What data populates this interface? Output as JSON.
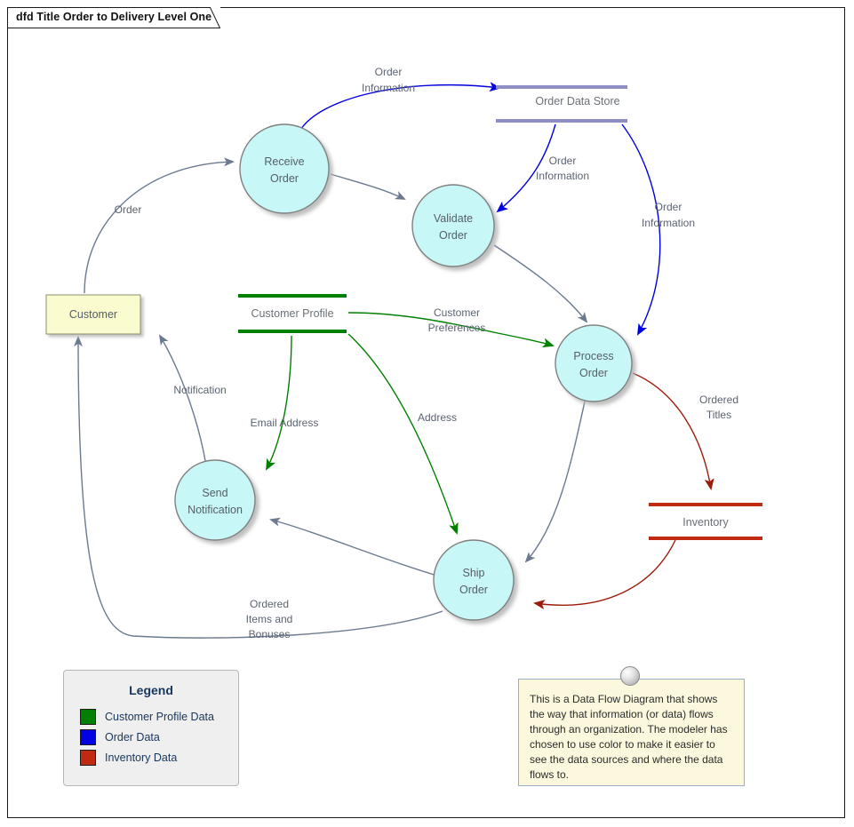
{
  "window": {
    "title_tab": "dfd Title Order to Delivery Level One"
  },
  "colors": {
    "order_data": "#0000e0",
    "customer_profile_data": "#008000",
    "inventory_data": "#c02a12",
    "generic_flow": "#6b7a90",
    "process_fill": "#c8f7f7",
    "process_stroke": "#808080",
    "entity_fill": "#fbfbd0",
    "entity_stroke": "#8d8d6e",
    "store_order": "#8e8ec4",
    "note_fill": "#fbf8dd",
    "legend_fill": "#efefef"
  },
  "processes": [
    {
      "id": "receive-order",
      "label_line1": "Receive",
      "label_line2": "Order"
    },
    {
      "id": "validate-order",
      "label_line1": "Validate",
      "label_line2": "Order"
    },
    {
      "id": "process-order",
      "label_line1": "Process",
      "label_line2": "Order"
    },
    {
      "id": "ship-order",
      "label_line1": "Ship",
      "label_line2": "Order"
    },
    {
      "id": "send-notification",
      "label_line1": "Send",
      "label_line2": "Notification"
    }
  ],
  "data_stores": [
    {
      "id": "order-data-store",
      "label": "Order Data Store",
      "color": "#8e8ec4"
    },
    {
      "id": "customer-profile-store",
      "label": "Customer Profile",
      "color": "#008000"
    },
    {
      "id": "inventory-store",
      "label": "Inventory",
      "color": "#c02a12"
    }
  ],
  "external_entities": [
    {
      "id": "customer-entity",
      "label": "Customer"
    }
  ],
  "flows": [
    {
      "id": "flow-order",
      "label": "Order",
      "lines": [
        "Order"
      ],
      "color": "#6b7a90",
      "from": "customer-entity",
      "to": "receive-order"
    },
    {
      "id": "flow-order-information-store-in",
      "label": "Order Information",
      "lines": [
        "Order",
        "Information"
      ],
      "color": "#0000e0",
      "from": "receive-order",
      "to": "order-data-store"
    },
    {
      "id": "flow-order-information-validate",
      "label": "Order Information",
      "lines": [
        "Order",
        "Information"
      ],
      "color": "#0000e0",
      "from": "order-data-store",
      "to": "validate-order"
    },
    {
      "id": "flow-order-information-process",
      "label": "Order Information",
      "lines": [
        "Order",
        "Information"
      ],
      "color": "#0000e0",
      "from": "order-data-store",
      "to": "process-order"
    },
    {
      "id": "flow-receive-to-validate",
      "label": "",
      "lines": [],
      "color": "#6b7a90",
      "from": "receive-order",
      "to": "validate-order"
    },
    {
      "id": "flow-validate-to-process",
      "label": "",
      "lines": [],
      "color": "#6b7a90",
      "from": "validate-order",
      "to": "process-order"
    },
    {
      "id": "flow-customer-preferences",
      "label": "Customer Preferences",
      "lines": [
        "Customer",
        "Preferences"
      ],
      "color": "#008000",
      "from": "customer-profile-store",
      "to": "process-order"
    },
    {
      "id": "flow-email-address",
      "label": "Email Address",
      "lines": [
        "Email Address"
      ],
      "color": "#008000",
      "from": "customer-profile-store",
      "to": "send-notification"
    },
    {
      "id": "flow-address",
      "label": "Address",
      "lines": [
        "Address"
      ],
      "color": "#008000",
      "from": "customer-profile-store",
      "to": "ship-order"
    },
    {
      "id": "flow-ordered-titles",
      "label": "Ordered Titles",
      "lines": [
        "Ordered",
        "Titles"
      ],
      "color": "#c02a12",
      "from": "process-order",
      "to": "inventory-store"
    },
    {
      "id": "flow-inventory-to-ship",
      "label": "",
      "lines": [],
      "color": "#c02a12",
      "from": "inventory-store",
      "to": "ship-order"
    },
    {
      "id": "flow-process-to-ship",
      "label": "",
      "lines": [],
      "color": "#6b7a90",
      "from": "process-order",
      "to": "ship-order"
    },
    {
      "id": "flow-notification",
      "label": "Notification",
      "lines": [
        "Notification"
      ],
      "color": "#6b7a90",
      "from": "send-notification",
      "to": "customer-entity"
    },
    {
      "id": "flow-ship-to-send-notification",
      "label": "",
      "lines": [],
      "color": "#6b7a90",
      "from": "ship-order",
      "to": "send-notification"
    },
    {
      "id": "flow-ordered-items-and-bonuses",
      "label": "Ordered Items and Bonuses",
      "lines": [
        "Ordered",
        "Items and",
        "Bonuses"
      ],
      "color": "#6b7a90",
      "from": "ship-order",
      "to": "customer-entity"
    }
  ],
  "legend": {
    "title": "Legend",
    "items": [
      {
        "color": "#008000",
        "label": "Customer Profile Data"
      },
      {
        "color": "#0000e0",
        "label": "Order Data"
      },
      {
        "color": "#c02a12",
        "label": "Inventory Data"
      }
    ]
  },
  "note": {
    "text": "This is a  Data Flow Diagram that shows the way that information (or data) flows through an organization. The modeler has chosen to use color to make it easier to see the data sources and where the data flows to."
  }
}
